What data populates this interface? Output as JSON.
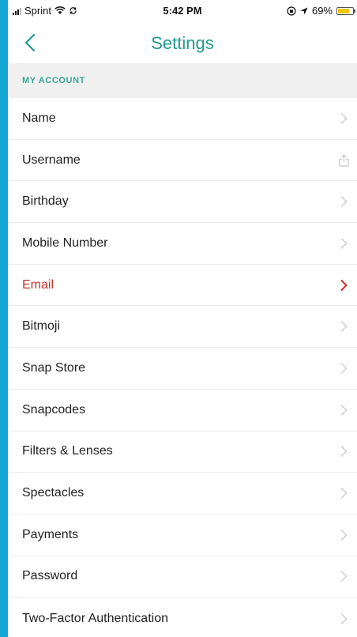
{
  "status_bar": {
    "carrier": "Sprint",
    "time": "5:42 PM",
    "battery_percent": "69%",
    "battery_level": 0.69,
    "battery_color": "#f2c50f"
  },
  "nav": {
    "title": "Settings",
    "title_color": "#21998a",
    "back_icon": "chevron-left-icon"
  },
  "section": {
    "header": "MY ACCOUNT",
    "header_color": "#3aa597"
  },
  "accent_color": "#c9302c",
  "items": [
    {
      "label": "Name",
      "icon": "chevron-right-icon"
    },
    {
      "label": "Username",
      "icon": "share-icon"
    },
    {
      "label": "Birthday",
      "icon": "chevron-right-icon"
    },
    {
      "label": "Mobile Number",
      "icon": "chevron-right-icon"
    },
    {
      "label": "Email",
      "icon": "chevron-right-icon",
      "active": true
    },
    {
      "label": "Bitmoji",
      "icon": "chevron-right-icon"
    },
    {
      "label": "Snap Store",
      "icon": "chevron-right-icon"
    },
    {
      "label": "Snapcodes",
      "icon": "chevron-right-icon"
    },
    {
      "label": "Filters & Lenses",
      "icon": "chevron-right-icon"
    },
    {
      "label": "Spectacles",
      "icon": "chevron-right-icon"
    },
    {
      "label": "Payments",
      "icon": "chevron-right-icon"
    },
    {
      "label": "Password",
      "icon": "chevron-right-icon"
    },
    {
      "label": "Two-Factor Authentication",
      "icon": "chevron-right-icon"
    }
  ]
}
